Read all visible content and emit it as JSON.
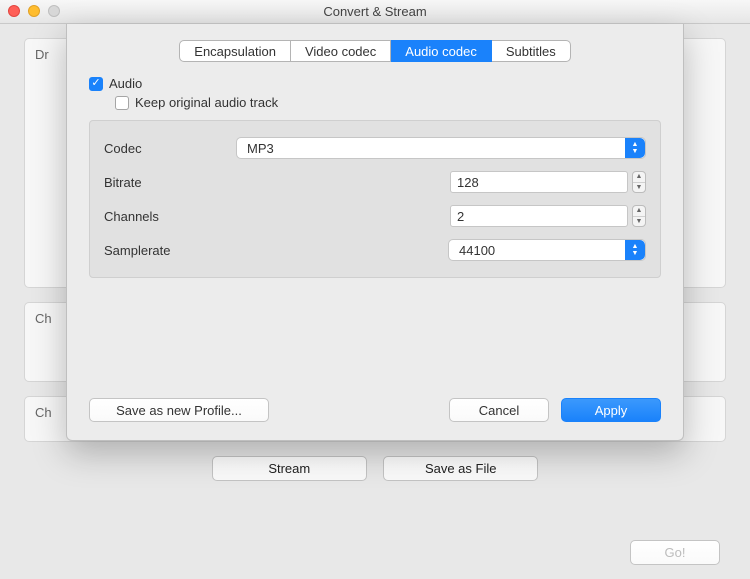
{
  "window": {
    "title": "Convert & Stream"
  },
  "background_labels": {
    "p1": "Dr",
    "p2": "Ch",
    "p3": "Ch"
  },
  "bottom_bar": {
    "stream": "Stream",
    "save_file": "Save as File",
    "go": "Go!"
  },
  "sheet": {
    "tabs": {
      "encapsulation": "Encapsulation",
      "video_codec": "Video codec",
      "audio_codec": "Audio codec",
      "subtitles": "Subtitles"
    },
    "audio": {
      "audio_label": "Audio",
      "audio_checked": true,
      "keep_label": "Keep original audio track",
      "keep_checked": false,
      "codec_label": "Codec",
      "codec_value": "MP3",
      "bitrate_label": "Bitrate",
      "bitrate_value": "128",
      "channels_label": "Channels",
      "channels_value": "2",
      "samplerate_label": "Samplerate",
      "samplerate_value": "44100"
    },
    "footer": {
      "save_profile": "Save as new Profile...",
      "cancel": "Cancel",
      "apply": "Apply"
    }
  }
}
